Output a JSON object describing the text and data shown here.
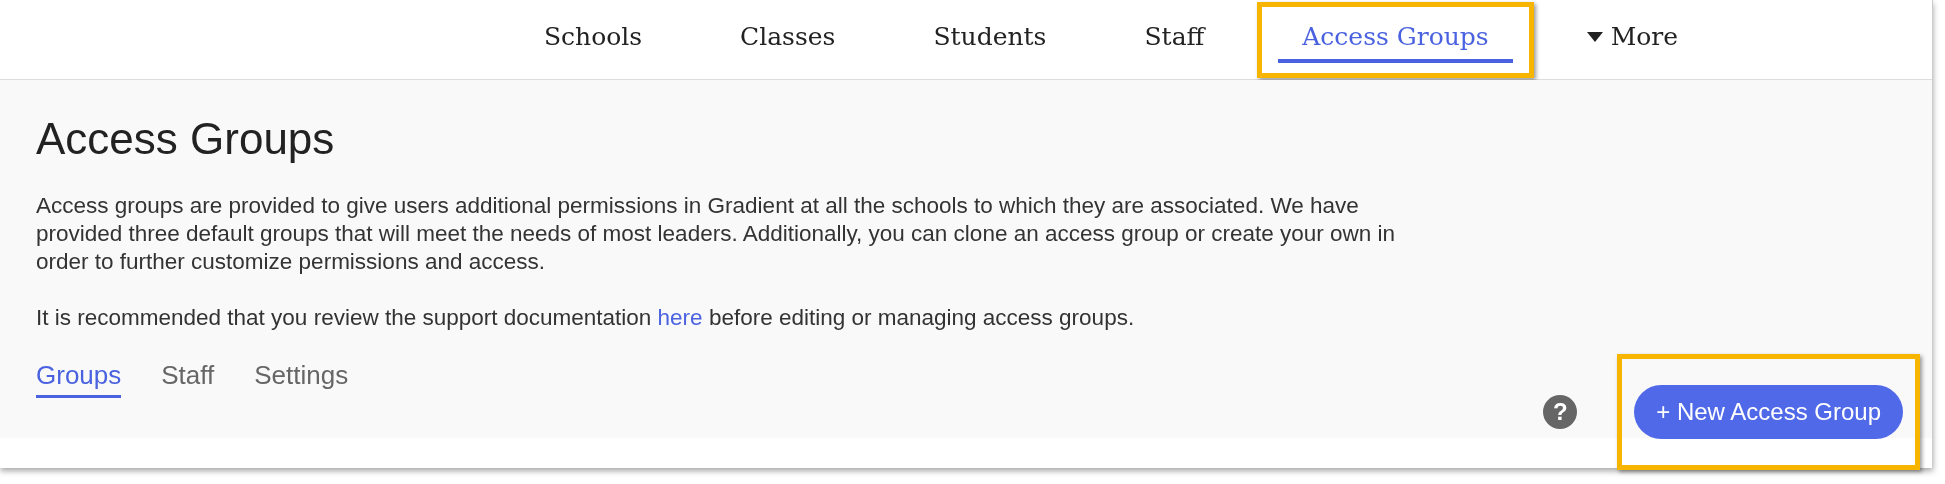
{
  "nav": [
    {
      "label": "Schools",
      "kind": "link",
      "selected": false,
      "highlighted": false
    },
    {
      "label": "Classes",
      "kind": "link",
      "selected": false,
      "highlighted": false
    },
    {
      "label": "Students",
      "kind": "link",
      "selected": false,
      "highlighted": false
    },
    {
      "label": "Staff",
      "kind": "link",
      "selected": false,
      "highlighted": false
    },
    {
      "label": "Access Groups",
      "kind": "link",
      "selected": true,
      "highlighted": true
    },
    {
      "label": "More",
      "kind": "dropdown",
      "selected": false,
      "highlighted": false
    }
  ],
  "title": "Access Groups",
  "intro": "Access groups are provided to give users additional permissions in Gradient at all the schools to which they are associated. We have provided three default groups that will meet the needs of most leaders. Additionally, you can clone an access group or create your own in order to further customize permissions and access.",
  "note": {
    "before": "It is recommended that you review the support documentation ",
    "link": "here",
    "after": " before editing or managing access groups."
  },
  "tabs": [
    {
      "label": "Groups",
      "selected": true
    },
    {
      "label": "Staff",
      "selected": false
    },
    {
      "label": "Settings",
      "selected": false
    }
  ],
  "help": {
    "glyph": "?"
  },
  "new_button": {
    "label": "+ New Access Group",
    "highlighted": true
  }
}
